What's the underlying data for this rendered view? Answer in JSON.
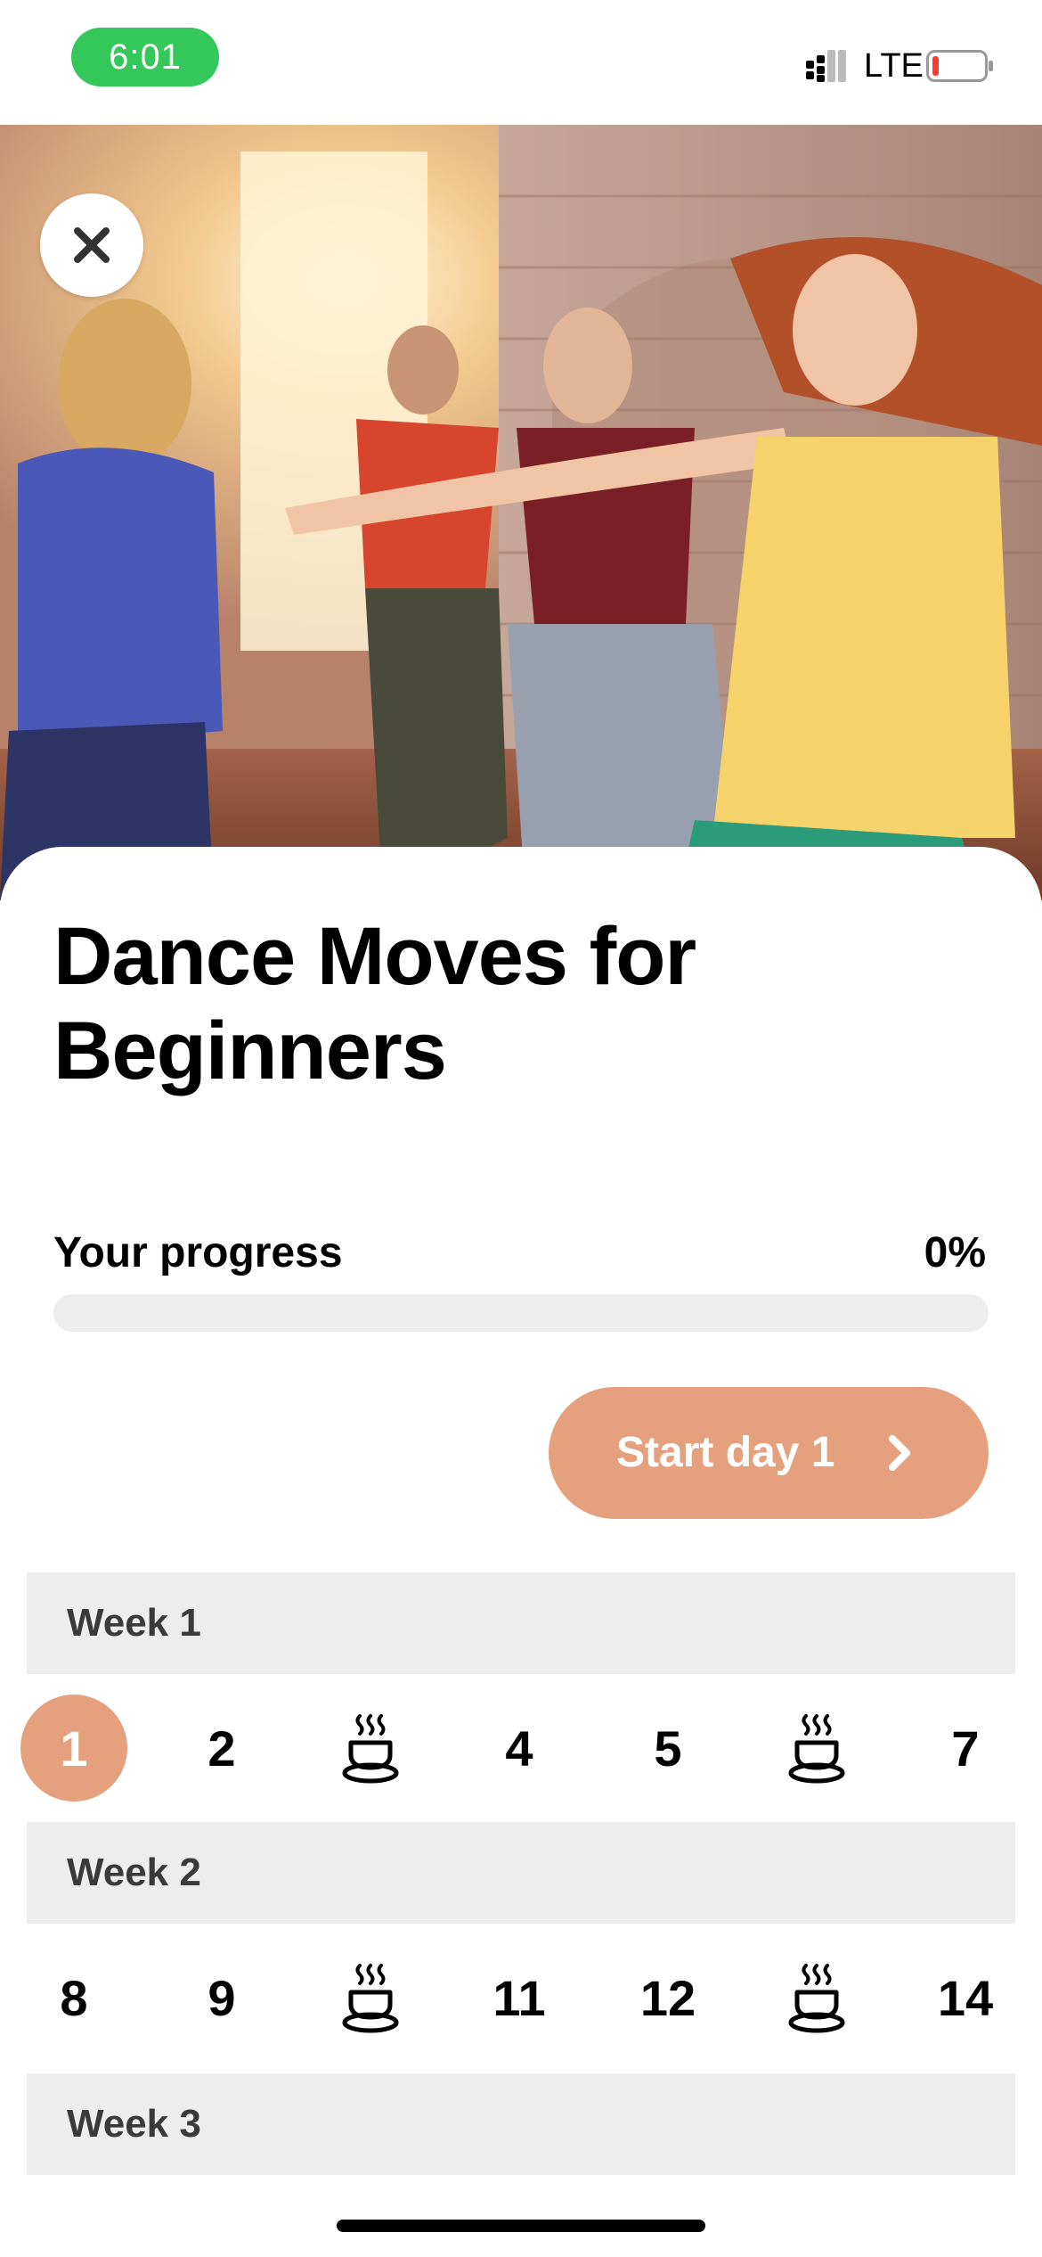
{
  "status_bar": {
    "time": "6:01",
    "network": "LTE",
    "time_pill_color": "#34c759",
    "battery_level_color": "#ff3b30"
  },
  "hero": {
    "image": "group-dancing-in-studio-photo",
    "close_icon": "close-icon"
  },
  "program": {
    "title": "Dance Moves for Beginners"
  },
  "progress": {
    "label": "Your progress",
    "value_text": "0%",
    "value": 0
  },
  "start_button": {
    "label": "Start day 1",
    "icon": "chevron-right-icon"
  },
  "weeks": [
    {
      "label": "Week 1",
      "days": [
        {
          "label": "1",
          "rest": false,
          "current": true
        },
        {
          "label": "2",
          "rest": false,
          "current": false
        },
        {
          "label": "",
          "rest": true,
          "current": false
        },
        {
          "label": "4",
          "rest": false,
          "current": false
        },
        {
          "label": "5",
          "rest": false,
          "current": false
        },
        {
          "label": "",
          "rest": true,
          "current": false
        },
        {
          "label": "7",
          "rest": false,
          "current": false
        }
      ]
    },
    {
      "label": "Week 2",
      "days": [
        {
          "label": "8",
          "rest": false,
          "current": false
        },
        {
          "label": "9",
          "rest": false,
          "current": false
        },
        {
          "label": "",
          "rest": true,
          "current": false
        },
        {
          "label": "11",
          "rest": false,
          "current": false
        },
        {
          "label": "12",
          "rest": false,
          "current": false
        },
        {
          "label": "",
          "rest": true,
          "current": false
        },
        {
          "label": "14",
          "rest": false,
          "current": false
        }
      ]
    },
    {
      "label": "Week 3",
      "days": []
    }
  ],
  "colors": {
    "accent": "#e5a07e",
    "week_header_bg": "#ededed",
    "progress_track": "#ededed"
  }
}
